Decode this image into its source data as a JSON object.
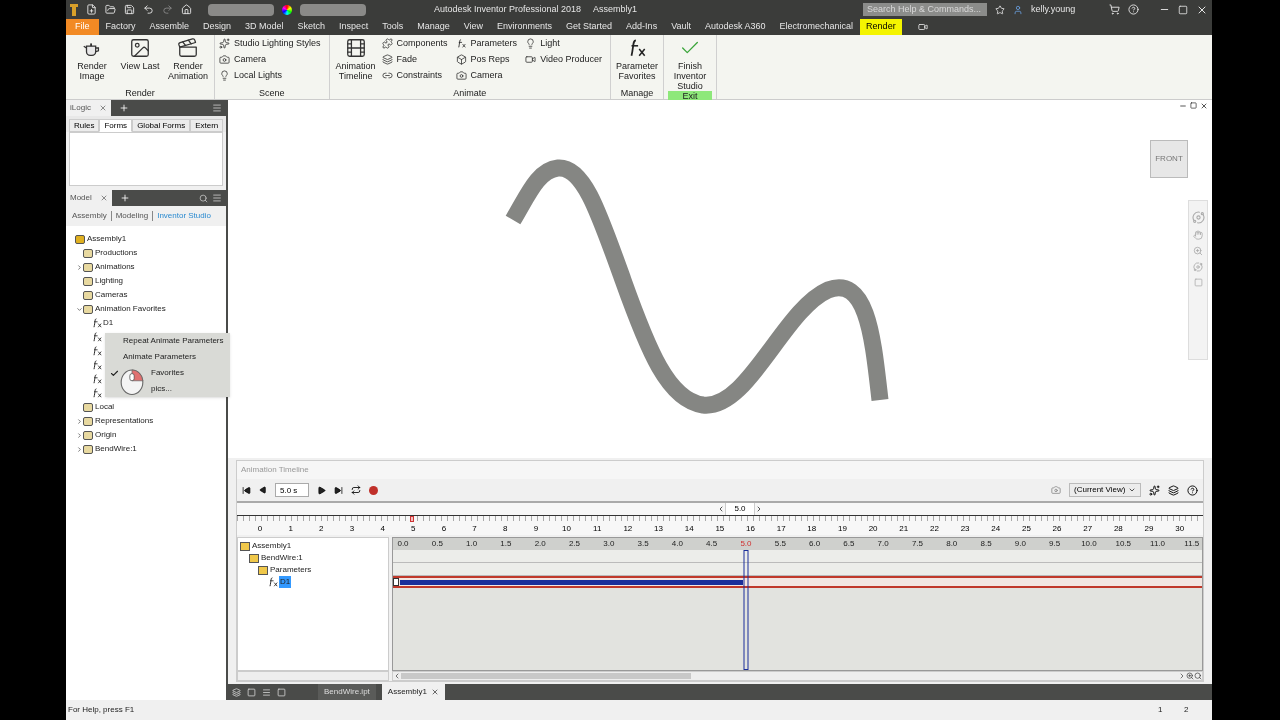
{
  "title_bar": {
    "product": "Autodesk Inventor Professional 2018",
    "document": "Assembly1",
    "search": {
      "placeholder": "Search Help & Commands..."
    },
    "user": "kelly.young"
  },
  "ribbon_tabs": [
    {
      "label": "File",
      "kind": "file",
      "selected": false
    },
    {
      "label": "Factory",
      "kind": "tab",
      "selected": false
    },
    {
      "label": "Assemble",
      "kind": "tab",
      "selected": false
    },
    {
      "label": "Design",
      "kind": "tab",
      "selected": false
    },
    {
      "label": "3D Model",
      "kind": "tab",
      "selected": false
    },
    {
      "label": "Sketch",
      "kind": "tab",
      "selected": false
    },
    {
      "label": "Inspect",
      "kind": "tab",
      "selected": false
    },
    {
      "label": "Tools",
      "kind": "tab",
      "selected": false
    },
    {
      "label": "Manage",
      "kind": "tab",
      "selected": false
    },
    {
      "label": "View",
      "kind": "tab",
      "selected": false
    },
    {
      "label": "Environments",
      "kind": "tab",
      "selected": false
    },
    {
      "label": "Get Started",
      "kind": "tab",
      "selected": false
    },
    {
      "label": "Add-Ins",
      "kind": "tab",
      "selected": false
    },
    {
      "label": "Vault",
      "kind": "tab",
      "selected": false
    },
    {
      "label": "Autodesk A360",
      "kind": "tab",
      "selected": false
    },
    {
      "label": "Electromechanical",
      "kind": "tab",
      "selected": false
    },
    {
      "label": "Render",
      "kind": "tab",
      "selected": true
    }
  ],
  "ribbon_groups": [
    {
      "title": "Render",
      "highlighted": false,
      "large": [
        "Render Image",
        "View Last",
        "Render Animation"
      ]
    },
    {
      "title": "Scene",
      "highlighted": false,
      "columns": [
        [
          "Studio Lighting Styles",
          "Camera",
          "Local Lights"
        ]
      ]
    },
    {
      "title": "Animate",
      "highlighted": false,
      "large": [
        "Animation Timeline"
      ],
      "columns": [
        [
          "Components",
          "Fade",
          "Constraints"
        ],
        [
          "Parameters",
          "Pos Reps",
          "Camera"
        ],
        [
          "Light",
          "Video Producer"
        ]
      ]
    },
    {
      "title": "Manage",
      "highlighted": false,
      "large": [
        "Parameter Favorites"
      ]
    },
    {
      "title": "Exit",
      "highlighted": true,
      "large": [
        "Finish Inventor Studio"
      ]
    }
  ],
  "ilogic_panel": {
    "title": "iLogic",
    "tabs": [
      {
        "label": "Rules",
        "selected": false
      },
      {
        "label": "Forms",
        "selected": true
      },
      {
        "label": "Global Forms",
        "selected": false
      },
      {
        "label": "Extern",
        "selected": false
      }
    ]
  },
  "model_panel": {
    "title": "Model",
    "modes": [
      {
        "label": "Assembly",
        "selected": false
      },
      {
        "label": "Modeling",
        "selected": false
      },
      {
        "label": "Inventor Studio",
        "selected": true
      }
    ],
    "tree": [
      {
        "label": "Assembly1",
        "children": [
          {
            "label": "Productions"
          },
          {
            "label": "Animations",
            "expanded": false
          },
          {
            "label": "Lighting"
          },
          {
            "label": "Cameras"
          },
          {
            "label": "Animation Favorites",
            "expanded": true,
            "children": [
              {
                "label": "D1",
                "kind": "parameter"
              },
              {
                "kind": "parameter"
              },
              {
                "kind": "parameter"
              },
              {
                "kind": "parameter"
              },
              {
                "kind": "parameter"
              },
              {
                "kind": "parameter"
              }
            ]
          },
          {
            "label": "Local"
          },
          {
            "label": "Representations",
            "expanded": false
          },
          {
            "label": "Origin",
            "expanded": false
          },
          {
            "label": "BendWire:1",
            "expanded": false
          }
        ]
      }
    ]
  },
  "context_menu": [
    {
      "label": "Repeat Animate Parameters",
      "checked": false
    },
    {
      "label": "Animate Parameters",
      "checked": false
    },
    {
      "label": "Favorites",
      "checked": true
    },
    {
      "label": "pics...",
      "checked": false
    }
  ],
  "view_cube": {
    "face": "FRONT"
  },
  "timeline": {
    "title": "Animation Timeline",
    "time": "5.0 s",
    "view": "(Current View)",
    "ruler_current": "5.0",
    "ruler": [
      "0",
      "1",
      "2",
      "3",
      "4",
      "5",
      "6",
      "7",
      "8",
      "9",
      "10",
      "11",
      "12",
      "13",
      "14",
      "15",
      "16",
      "17",
      "18",
      "19",
      "20",
      "21",
      "22",
      "23",
      "24",
      "25",
      "26",
      "27",
      "28",
      "29",
      "30"
    ],
    "scale": [
      {
        "label": "0.0",
        "current": false
      },
      {
        "label": "0.5",
        "current": false
      },
      {
        "label": "1.0",
        "current": false
      },
      {
        "label": "1.5",
        "current": false
      },
      {
        "label": "2.0",
        "current": false
      },
      {
        "label": "2.5",
        "current": false
      },
      {
        "label": "3.0",
        "current": false
      },
      {
        "label": "3.5",
        "current": false
      },
      {
        "label": "4.0",
        "current": false
      },
      {
        "label": "4.5",
        "current": false
      },
      {
        "label": "5.0",
        "current": true
      },
      {
        "label": "5.5",
        "current": false
      },
      {
        "label": "6.0",
        "current": false
      },
      {
        "label": "6.5",
        "current": false
      },
      {
        "label": "7.0",
        "current": false
      },
      {
        "label": "7.5",
        "current": false
      },
      {
        "label": "8.0",
        "current": false
      },
      {
        "label": "8.5",
        "current": false
      },
      {
        "label": "9.0",
        "current": false
      },
      {
        "label": "9.5",
        "current": false
      },
      {
        "label": "10.0",
        "current": false
      },
      {
        "label": "10.5",
        "current": false
      },
      {
        "label": "11.0",
        "current": false
      },
      {
        "label": "11.5",
        "current": false
      }
    ],
    "tree": [
      {
        "label": "Assembly1",
        "selected": false,
        "children": [
          {
            "label": "BendWire:1",
            "selected": false,
            "children": [
              {
                "label": "Parameters",
                "selected": false,
                "children": [
                  {
                    "label": "D1",
                    "selected": true
                  }
                ]
              }
            ]
          }
        ]
      }
    ]
  },
  "document_tabs": [
    {
      "label": "BendWire.ipt",
      "selected": false
    },
    {
      "label": "Assembly1",
      "selected": true
    }
  ],
  "status_bar": {
    "help": "For Help, press F1",
    "pages": [
      "1",
      "2"
    ]
  }
}
